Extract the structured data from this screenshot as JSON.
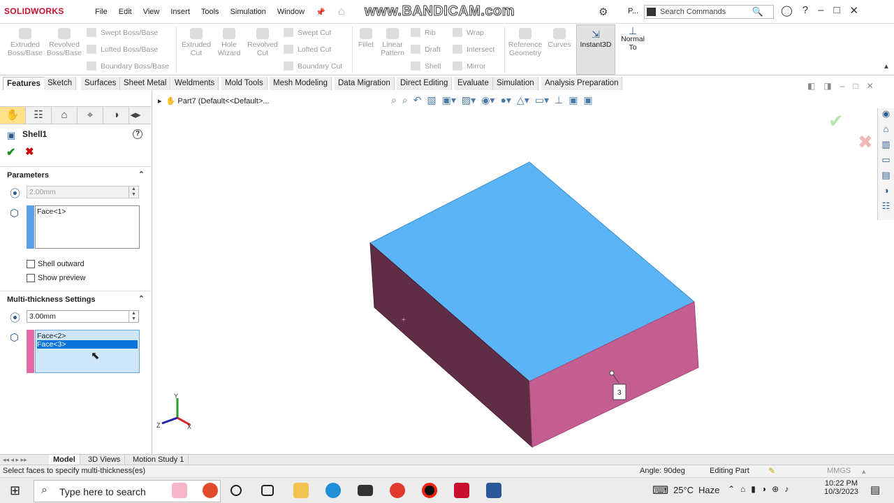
{
  "app": {
    "name": "SOLIDWORKS",
    "watermark": "www.BANDICAM.com",
    "profile": "P..."
  },
  "menu": [
    "File",
    "Edit",
    "View",
    "Insert",
    "Tools",
    "Simulation",
    "Window"
  ],
  "search": {
    "placeholder": "Search Commands"
  },
  "ribbon": {
    "extruded_boss": "Extruded\nBoss/Base",
    "revolved_boss": "Revolved\nBoss/Base",
    "swept_boss": "Swept Boss/Base",
    "lofted_boss": "Lofted Boss/Base",
    "boundary_boss": "Boundary Boss/Base",
    "extruded_cut": "Extruded\nCut",
    "hole_wizard": "Hole\nWizard",
    "revolved_cut": "Revolved\nCut",
    "swept_cut": "Swept Cut",
    "lofted_cut": "Lofted Cut",
    "boundary_cut": "Boundary Cut",
    "fillet": "Fillet",
    "linear_pattern": "Linear\nPattern",
    "rib": "Rib",
    "draft": "Draft",
    "shell": "Shell",
    "wrap": "Wrap",
    "intersect": "Intersect",
    "mirror": "Mirror",
    "reference_geometry": "Reference\nGeometry",
    "curves": "Curves",
    "instant3d": "Instant3D",
    "normal_to": "Normal\nTo"
  },
  "tabs": [
    "Features",
    "Sketch",
    "Surfaces",
    "Sheet Metal",
    "Weldments",
    "Mold Tools",
    "Mesh Modeling",
    "Data Migration",
    "Direct Editing",
    "Evaluate",
    "Simulation",
    "Analysis Preparation"
  ],
  "property_manager": {
    "title": "Shell1",
    "parameters_header": "Parameters",
    "thickness": "2.00mm",
    "faces_to_remove": [
      "Face<1>"
    ],
    "shell_outward": "Shell outward",
    "show_preview": "Show preview",
    "multi_header": "Multi-thickness Settings",
    "multi_thickness": "3.00mm",
    "multi_faces": [
      "Face<2>",
      "Face<3>"
    ],
    "selected_face": "Face<3>"
  },
  "viewport": {
    "breadcrumb": "Part7  (Default<<Default>...",
    "callout": "3"
  },
  "colors": {
    "top_face": "#5ab4f6",
    "left_face": "#5f2d45",
    "right_face": "#c45e90",
    "selection": "#0a74da",
    "accent_blue": "#5aa0e8",
    "accent_pink": "#e36aa6"
  },
  "bottom_tabs": [
    "Model",
    "3D Views",
    "Motion Study 1"
  ],
  "status": {
    "message": "Select faces to specify multi-thickness(es)",
    "angle": "Angle: 90deg",
    "mode": "Editing Part",
    "units": "MMGS"
  },
  "taskbar": {
    "search": "Type here to search",
    "temp": "25°C",
    "weather": "Haze",
    "time": "10:22 PM",
    "date": "10/3/2023"
  },
  "icons": [
    "search-icon",
    "home-icon",
    "gear-icon",
    "help-icon",
    "ok-check-icon",
    "cancel-x-icon",
    "triad-icon",
    "windows-icon"
  ]
}
